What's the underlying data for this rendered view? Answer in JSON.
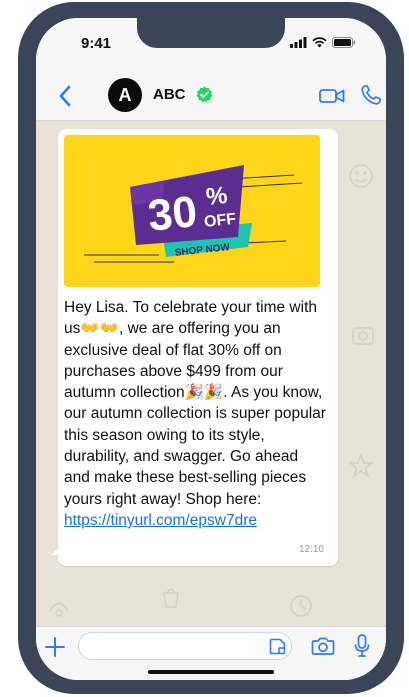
{
  "status_bar": {
    "time": "9:41"
  },
  "header": {
    "avatar_letter": "A",
    "contact_name": "ABC",
    "verified": true
  },
  "message": {
    "promo": {
      "discount_number": "30",
      "percent_sign": "%",
      "off_label": "OFF",
      "cta_label": "SHOP NOW"
    },
    "text": "Hey Lisa. To celebrate your time with us👐👐, we are offering you an exclusive deal of flat 30% off on purchases above $499 from our autumn collection🎉🎉. As you know, our autumn collection is super popular this season owing to its style, durability, and swagger. Go ahead and make these best-selling pieces yours right away! Shop here:",
    "link": "https://tinyurl.com/epsw7dre",
    "time": "12:10"
  },
  "input_bar": {
    "placeholder": ""
  },
  "colors": {
    "accent_blue": "#2f7cf6",
    "verified_green": "#25d366",
    "promo_yellow": "#fdd51a",
    "promo_purple": "#5c2d91",
    "promo_teal": "#20c2b0",
    "phone_frame": "#3a4657"
  },
  "icons": {
    "back": "chevron-left-icon",
    "video": "video-camera-icon",
    "call": "phone-icon",
    "plus": "plus-icon",
    "sticker": "sticker-icon",
    "camera": "camera-icon",
    "mic": "microphone-icon"
  }
}
